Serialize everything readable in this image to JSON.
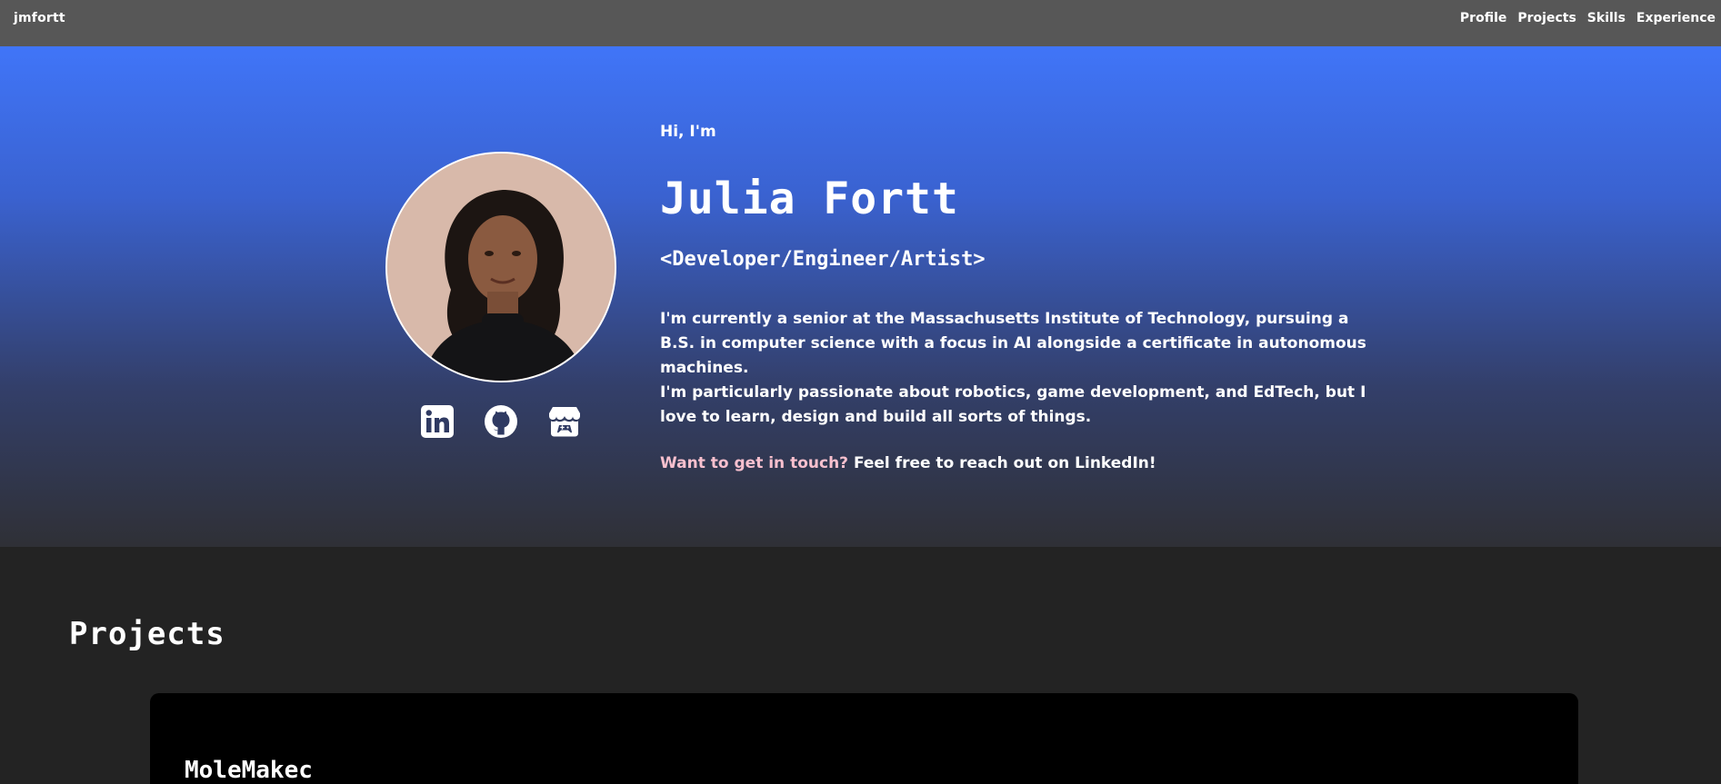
{
  "navbar": {
    "brand": "jmfortt",
    "links": [
      "Profile",
      "Projects",
      "Skills",
      "Experience"
    ]
  },
  "hero": {
    "greeting": "Hi, I'm",
    "name": "Julia Fortt",
    "roles": "<Developer/Engineer/Artist>",
    "paragraphs": [
      "I'm currently a senior at the Massachusetts Institute of Technology, pursuing a B.S. in computer science with a focus in AI alongside a certificate in autonomous machines.",
      "I'm particularly passionate about robotics, game development, and EdTech, but I love to learn, design and build all sorts of things."
    ],
    "contact_link": "Want to get in touch?",
    "contact_text": " Feel free to reach out on LinkedIn!",
    "socials": [
      {
        "name": "LinkedIn",
        "icon": "linkedin-icon"
      },
      {
        "name": "GitHub",
        "icon": "github-icon"
      },
      {
        "name": "itch.io",
        "icon": "itchio-icon"
      }
    ]
  },
  "projects": {
    "heading": "Projects",
    "items": [
      {
        "title": "MoleMakec"
      }
    ]
  },
  "colors": {
    "navbar_bg": "#575757",
    "hero_gradient_top": "#4075f8",
    "hero_gradient_bottom": "#2f3036",
    "page_bg": "#232323",
    "card_bg": "#000000",
    "contact_accent": "#f8c0ce"
  }
}
